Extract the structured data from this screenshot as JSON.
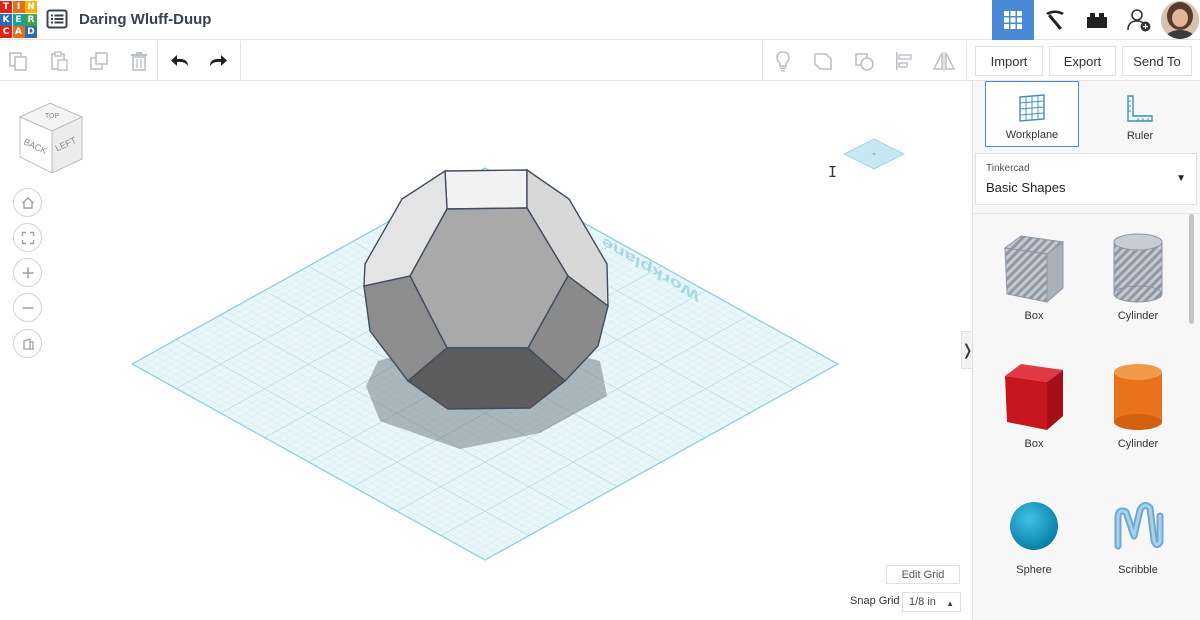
{
  "app": {
    "logo_letters": [
      "T",
      "I",
      "N",
      "K",
      "E",
      "R",
      "C",
      "A",
      "D"
    ],
    "logo_colors": [
      "#e2231a",
      "#e46f1a",
      "#f4b400",
      "#2d6cb1",
      "#1f9c9c",
      "#3fa14a",
      "#e2231a",
      "#e46f1a",
      "#2d6cb1"
    ],
    "design_title": "Daring Wluff-Duup",
    "accent_color": "#4a8ad4"
  },
  "header": {
    "right_icons": [
      "3d-design-grid-icon",
      "pickaxe-icon",
      "bricks-icon",
      "user-add-icon"
    ]
  },
  "toolbar": {
    "icons": [
      "copy-icon",
      "paste-icon",
      "duplicate-icon",
      "delete-icon",
      "undo-icon",
      "redo-icon",
      "light-bulb-icon",
      "group-icon",
      "ungroup-icon",
      "align-icon",
      "mirror-icon"
    ],
    "import_label": "Import",
    "export_label": "Export",
    "send_to_label": "Send To"
  },
  "view_cube": {
    "faces": [
      "TOP",
      "BACK",
      "LEFT"
    ]
  },
  "navigation": {
    "buttons": [
      "home-icon",
      "fit-view-icon",
      "zoom-in-icon",
      "zoom-out-icon",
      "perspective-icon"
    ]
  },
  "workplane": {
    "watermark": "Workplane",
    "grid_color": "#a9dcec"
  },
  "canvas_controls": {
    "edit_grid_label": "Edit Grid",
    "snap_grid_label": "Snap Grid",
    "snap_grid_value": "1/8 in",
    "panel_toggle": "❭"
  },
  "panel": {
    "workplane_label": "Workplane",
    "ruler_label": "Ruler",
    "library_provider": "Tinkercad",
    "library_name": "Basic Shapes",
    "shapes": [
      {
        "label": "Box",
        "icon": "box-hole-icon"
      },
      {
        "label": "Cylinder",
        "icon": "cylinder-hole-icon"
      },
      {
        "label": "Box",
        "icon": "box-red-icon"
      },
      {
        "label": "Cylinder",
        "icon": "cylinder-orange-icon"
      },
      {
        "label": "Sphere",
        "icon": "sphere-blue-icon"
      },
      {
        "label": "Scribble",
        "icon": "scribble-icon"
      }
    ]
  }
}
